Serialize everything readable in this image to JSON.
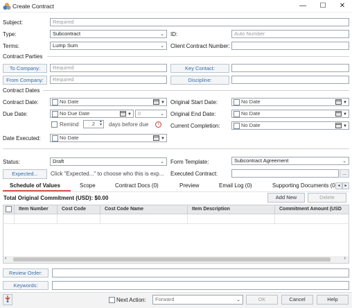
{
  "window": {
    "title": "Create Contract",
    "minimize": "—",
    "maximize": "☐",
    "close": "✕"
  },
  "subject": {
    "label": "Subject:",
    "placeholder": "Required"
  },
  "type": {
    "label": "Type:",
    "value": "Subcontract"
  },
  "id": {
    "label": "ID:",
    "placeholder": "Auto Number"
  },
  "terms": {
    "label": "Terms:",
    "value": "Lump Sum"
  },
  "client_contract_number": {
    "label": "Client Contract Number:",
    "value": ""
  },
  "parties": {
    "section": "Contract Parties",
    "to_company": "To Company:",
    "to_company_placeholder": "Required",
    "from_company": "From Company:",
    "from_company_placeholder": "Required",
    "key_contact": "Key Contact:",
    "discipline": "Discipline:"
  },
  "dates": {
    "section": "Contract Dates",
    "contract_date": "Contract Date:",
    "contract_date_value": "No Date",
    "due_date": "Due Date:",
    "due_date_value": "No Due Date",
    "due_offset": "0",
    "remind": "Remind",
    "remind_days": "2",
    "remind_suffix": "days before due",
    "date_executed": "Date Executed:",
    "date_executed_value": "No Date",
    "original_start": "Original Start Date:",
    "original_start_value": "No Date",
    "original_end": "Original End Date:",
    "original_end_value": "No Date",
    "current_completion": "Current Completion:",
    "current_completion_value": "No Date"
  },
  "status": {
    "label": "Status:",
    "value": "Draft"
  },
  "form_template": {
    "label": "Form Template:",
    "value": "Subcontract Agreement"
  },
  "expected": {
    "button": "Expected...",
    "hint": "Click \"Expected...\" to choose who this is exp..."
  },
  "executed_contract": {
    "label": "Executed Contract:",
    "browse": "..."
  },
  "tabs": [
    {
      "label": "Schedule of Values"
    },
    {
      "label": "Scope"
    },
    {
      "label": "Contract Docs (0)"
    },
    {
      "label": "Preview"
    },
    {
      "label": "Email Log (0)"
    },
    {
      "label": "Supporting Documents (0"
    }
  ],
  "sov": {
    "total": "Total Original Commitment (USD): $0.00",
    "add_new": "Add New",
    "delete": "Delete",
    "columns": [
      "Item Number",
      "Cost Code",
      "Cost Code Name",
      "Item Description",
      "Commitment Amount (USD"
    ]
  },
  "review_order": "Review Order:",
  "keywords": "Keywords:",
  "footer": {
    "next_action": "Next Action:",
    "next_action_value": "Forward",
    "ok": "OK",
    "cancel": "Cancel",
    "help": "Help"
  },
  "colors": {
    "tab_underline": "#d9534f",
    "label_button_text": "#3b6ea5"
  }
}
